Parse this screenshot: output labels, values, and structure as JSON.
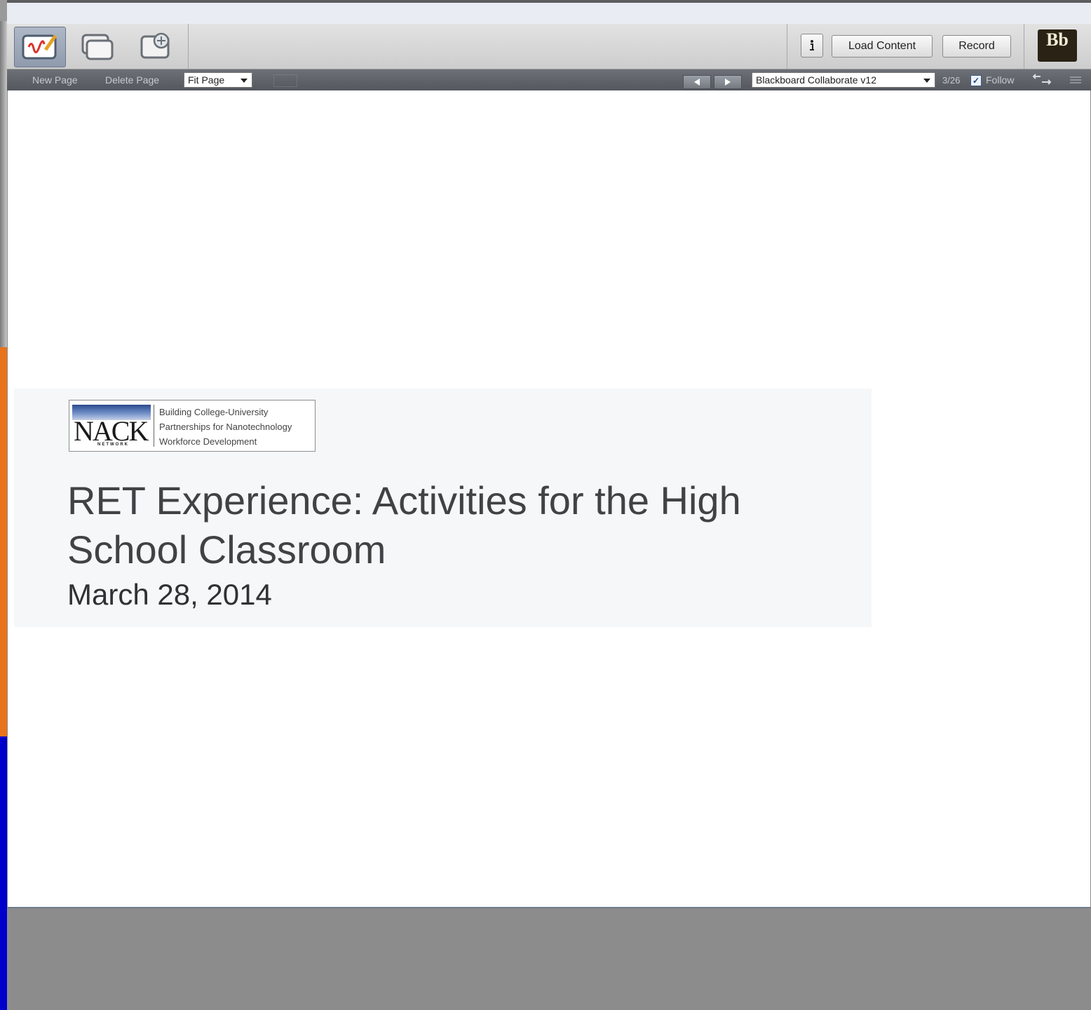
{
  "toolbar": {
    "tools": [
      {
        "icon": "whiteboard-icon",
        "active": true
      },
      {
        "icon": "application-sharing-icon",
        "active": false
      },
      {
        "icon": "web-tour-icon",
        "active": false
      }
    ],
    "info_icon": "info-icon",
    "load_content_label": "Load Content",
    "record_label": "Record",
    "logo_text": "Bb"
  },
  "subbar": {
    "new_page_label": "New Page",
    "delete_page_label": "Delete Page",
    "zoom_value": "Fit Page",
    "document_value": "Blackboard Collaborate v12",
    "page_count": "3/26",
    "follow_label": "Follow",
    "follow_checked": true
  },
  "slide": {
    "logo": {
      "name": "NACK",
      "subname": "NETWORK",
      "tagline": [
        "Building College-University",
        "Partnerships for Nanotechnology",
        "Workforce Development"
      ]
    },
    "title": "RET Experience: Activities for the High School Classroom",
    "date": "March 28, 2014"
  },
  "colors": {
    "orange_strip": "#e8731c",
    "blue_strip": "#0000cc",
    "subbar": "#5e6268",
    "slide_text": "#404244"
  }
}
